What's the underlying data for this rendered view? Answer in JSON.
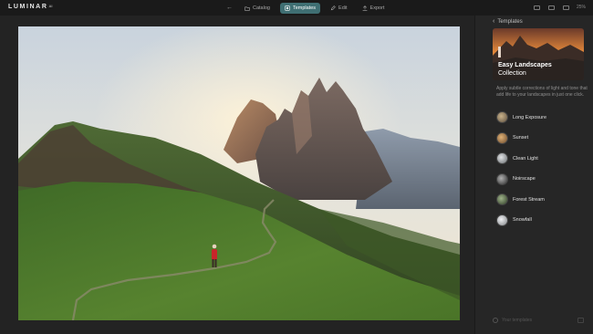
{
  "app": {
    "logo": "LUMINAR",
    "logo_version": "AI"
  },
  "nav": {
    "back": "←",
    "items": [
      {
        "label": "Catalog",
        "icon": "folder-icon",
        "active": false
      },
      {
        "label": "Templates",
        "icon": "templates-icon",
        "active": true
      },
      {
        "label": "Edit",
        "icon": "edit-icon",
        "active": false
      },
      {
        "label": "Export",
        "icon": "export-icon",
        "active": false
      }
    ]
  },
  "toolbar_right": {
    "zoom": "25%"
  },
  "panel": {
    "back_label": "Templates",
    "hero_title_bold": "Easy Landscapes",
    "hero_title_rest": "Collection",
    "description": "Apply subtle corrections of light and tone that add life to your landscapes in just one click.",
    "templates": [
      {
        "label": "Long Exposure",
        "thumb": "#8b7a5e"
      },
      {
        "label": "Sunset",
        "thumb": "#a07848"
      },
      {
        "label": "Clean Light",
        "thumb": "#9ea2a4"
      },
      {
        "label": "Noirscape",
        "thumb": "#6c6c6c"
      },
      {
        "label": "Forest Stream",
        "thumb": "#5b6e4c"
      },
      {
        "label": "Snowfall",
        "thumb": "#b5b8bc"
      }
    ],
    "footer": "Your templates"
  },
  "colors": {
    "accent": "#3f6f73",
    "panel_bg": "#262626",
    "canvas_bg": "#232323"
  }
}
